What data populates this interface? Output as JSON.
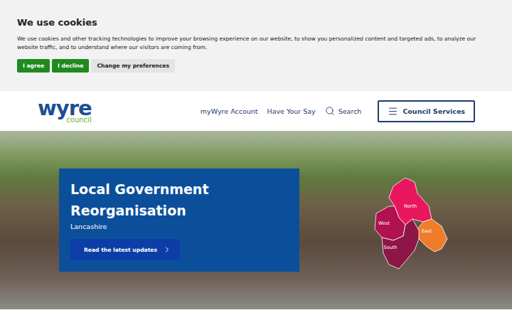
{
  "cookie_banner": {
    "title": "We use cookies",
    "message": "We use cookies and other tracking technologies to improve your browsing experience on our website, to show you personalized content and targeted ads, to analyze our website traffic, and to understand where our visitors are coming from.",
    "buttons": [
      {
        "label": "I agree",
        "kind": "primary"
      },
      {
        "label": "I decline",
        "kind": "primary"
      },
      {
        "label": "Change my preferences",
        "kind": "secondary"
      }
    ]
  },
  "header": {
    "logo": {
      "name": "wyre",
      "sub": "council"
    },
    "nav": [
      "myWyre Account",
      "Have Your Say"
    ],
    "search": "Search",
    "menu_button": "Council Services"
  },
  "hero": {
    "title": "Local Government Reorganisation",
    "subtitle": "Lancashire",
    "button": "Read the latest updates",
    "map": {
      "regions": [
        {
          "name": "North",
          "color": "#e8175d"
        },
        {
          "name": "West",
          "color": "#b0124f"
        },
        {
          "name": "East",
          "color": "#f07c2a"
        },
        {
          "name": "South",
          "color": "#8e1646"
        }
      ]
    }
  }
}
